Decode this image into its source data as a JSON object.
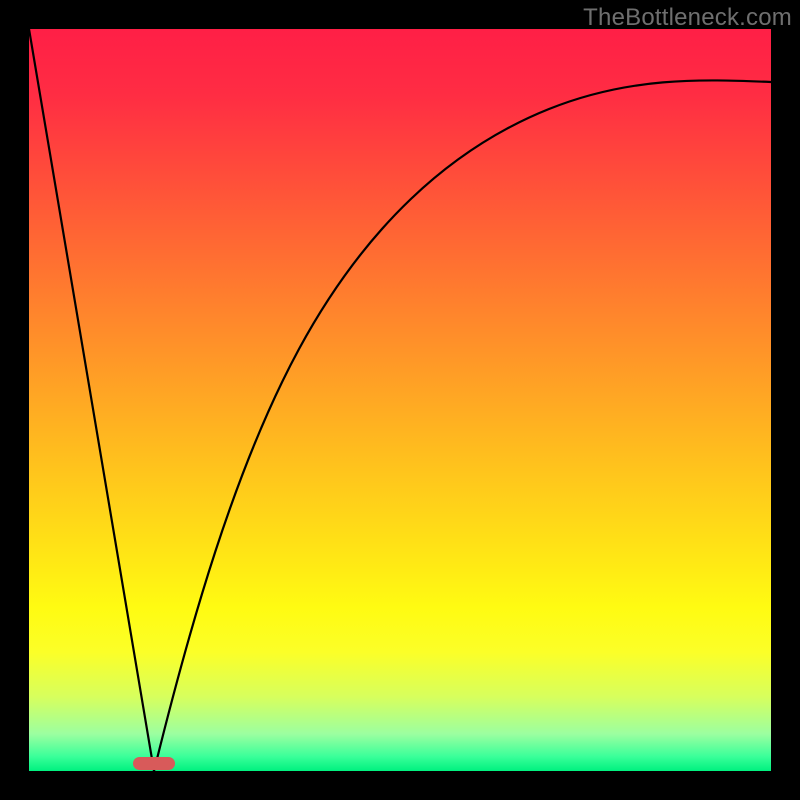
{
  "watermark": "TheBottleneck.com",
  "chart_data": {
    "type": "line",
    "title": "",
    "xlabel": "",
    "ylabel": "",
    "xlim": [
      0,
      100
    ],
    "ylim": [
      0,
      100
    ],
    "grid": false,
    "series": [
      {
        "name": "left-line",
        "x": [
          0,
          16.8
        ],
        "values": [
          100,
          0
        ]
      },
      {
        "name": "right-curve",
        "x": [
          16.8,
          20,
          25,
          30,
          35,
          40,
          45,
          50,
          55,
          60,
          65,
          70,
          75,
          80,
          85,
          90,
          95,
          100
        ],
        "values": [
          0,
          14,
          30,
          42,
          52,
          60,
          66.5,
          72,
          76.5,
          80,
          83,
          85.5,
          87.5,
          89,
          90.3,
          91.3,
          92.1,
          92.8
        ]
      }
    ],
    "marker": {
      "x_start": 14,
      "x_end": 19.5,
      "y": 0,
      "color": "#d85a5a"
    },
    "background_gradient": {
      "top": "#ff1f46",
      "bottom": "#00f17f"
    }
  }
}
